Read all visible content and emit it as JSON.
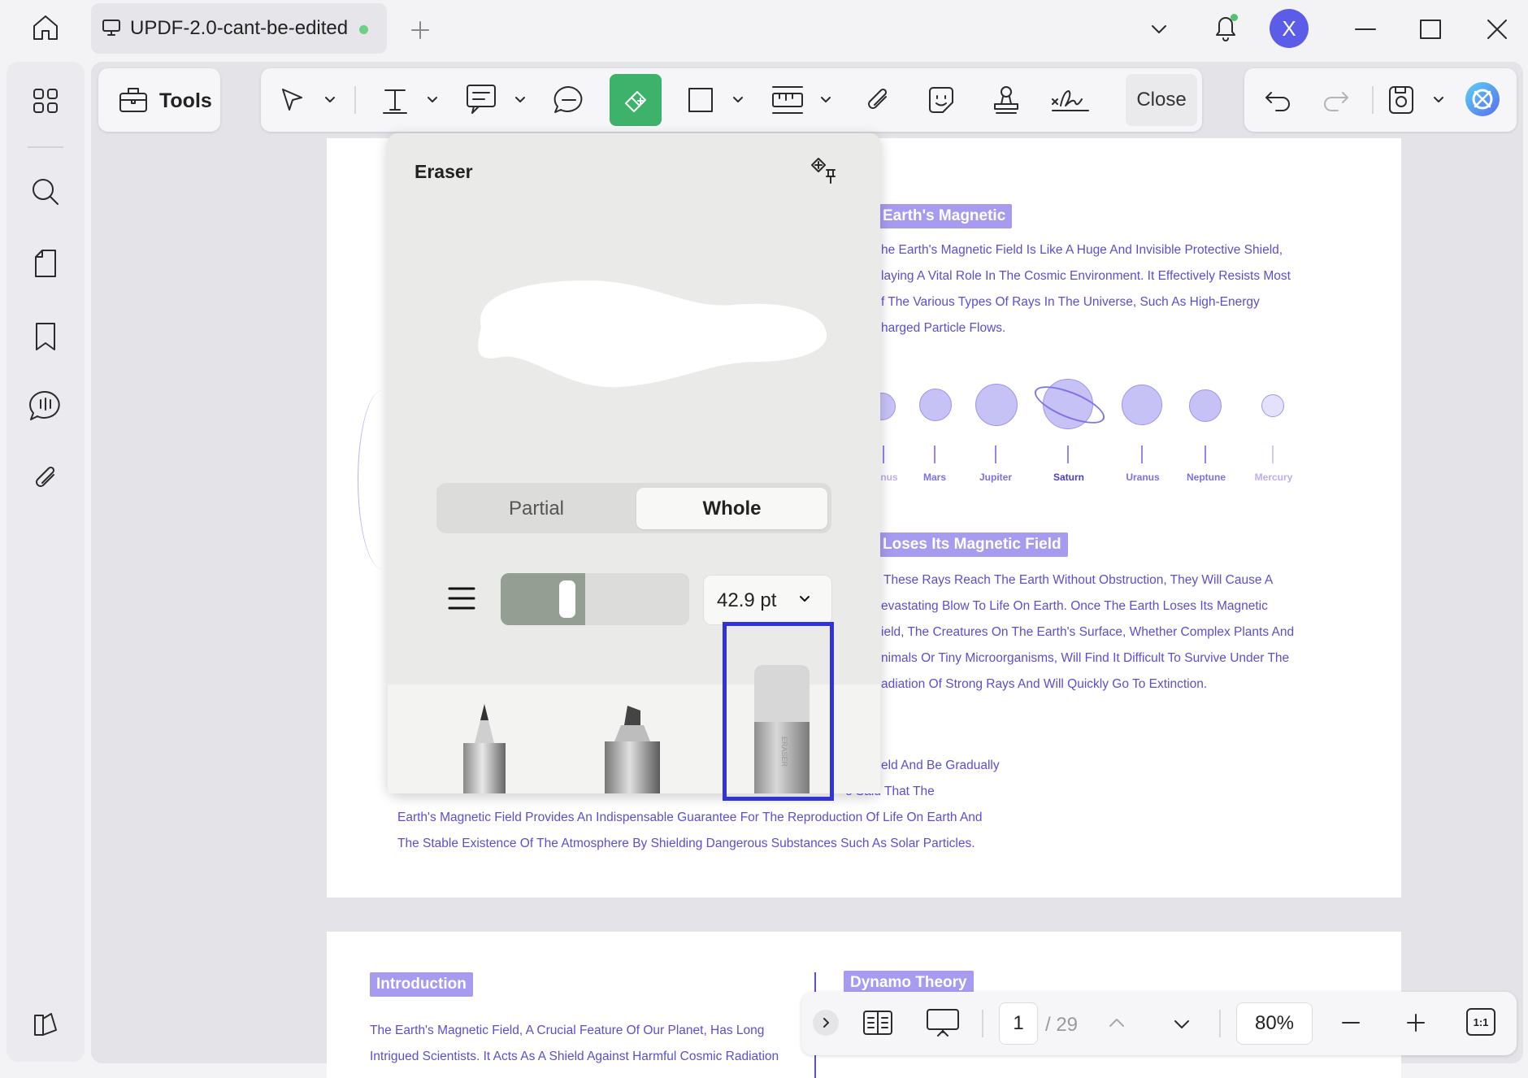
{
  "titlebar": {
    "tab_title": "UPDF-2.0-cant-be-edited",
    "avatar_letter": "X"
  },
  "toolbar": {
    "tools_label": "Tools",
    "close_label": "Close"
  },
  "eraser_panel": {
    "title": "Eraser",
    "mode_partial": "Partial",
    "mode_whole": "Whole",
    "selected_mode": "Whole",
    "size_value": "42.9 pt",
    "size_fraction": 0.45
  },
  "document": {
    "heading_magnetic": "Earth's Magnetic",
    "para_magnetic": [
      "he Earth's Magnetic Field Is Like A Huge And Invisible Protective Shield,",
      "laying A Vital Role In The Cosmic Environment. It Effectively Resists Most",
      "f The Various Types Of Rays In The Universe, Such As High-Energy",
      "harged Particle Flows."
    ],
    "planets": [
      "nus",
      "Mars",
      "Jupiter",
      "Saturn",
      "Uranus",
      "Neptune",
      "Mercury"
    ],
    "heading_loses": "Loses Its Magnetic Field",
    "para_loses": [
      "These Rays Reach The Earth Without Obstruction, They Will Cause A",
      "evastating Blow To Life On Earth. Once The Earth Loses Its Magnetic",
      "ield, The Creatures On The Earth's Surface, Whether Complex Plants And",
      "nimals Or Tiny Microorganisms, Will Find It Difficult To Survive Under The",
      "adiation Of Strong Rays And Will Quickly Go To Extinction."
    ],
    "para_bottom": [
      "eld And Be Gradually",
      "e Said That The",
      "Earth's Magnetic Field Provides An Indispensable Guarantee For The Reproduction Of Life On Earth And",
      "The Stable Existence Of The Atmosphere By Shielding Dangerous Substances Such As Solar Particles."
    ],
    "page2_heading_intro": "Introduction",
    "page2_heading_dynamo": "Dynamo Theory",
    "page2_para": [
      "The Earth's Magnetic Field, A Crucial Feature Of Our Planet, Has Long",
      "Intrigued Scientists. It Acts As A Shield Against Harmful Cosmic Radiation"
    ]
  },
  "bottom_bar": {
    "current_page": "1",
    "total_pages": "/ 29",
    "zoom": "80%",
    "actual_size_label": "1:1"
  },
  "colors": {
    "accent": "#3cb26a",
    "highlight": "#3034d8",
    "avatar": "#5b5ce8",
    "doc_text": "#5a4fd0"
  }
}
